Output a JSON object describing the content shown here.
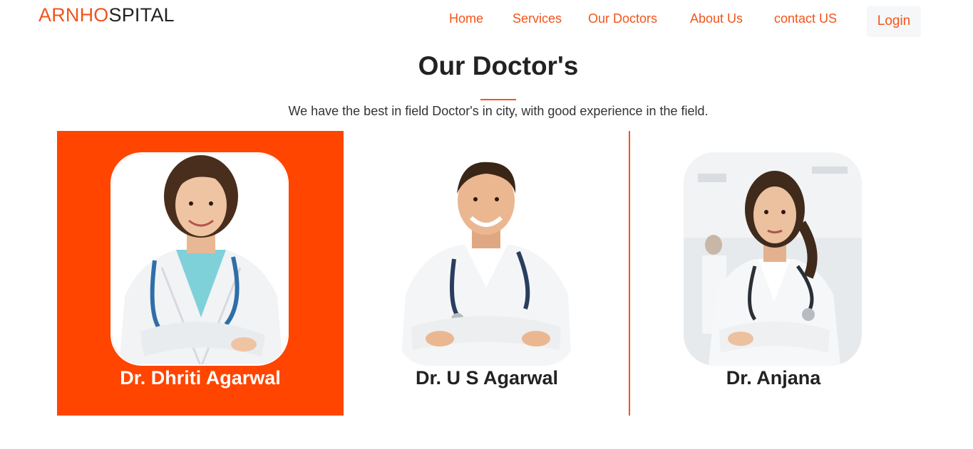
{
  "brand": {
    "accent": "ARNHO",
    "rest": "SPITAL"
  },
  "nav": {
    "items": [
      "Home",
      "Services",
      "Our Doctors",
      "About Us",
      "contact US"
    ],
    "login": "Login"
  },
  "section": {
    "title": "Our Doctor's",
    "subtitle": "We have the best in field Doctor's in city, with good experience in the field."
  },
  "doctors": [
    {
      "name": "Dr. Dhriti Agarwal",
      "selected": true,
      "photo": "female-doctor-smiling-photo"
    },
    {
      "name": "Dr. U S Agarwal",
      "selected": false,
      "photo": "male-doctor-smiling-photo"
    },
    {
      "name": "Dr. Anjana",
      "selected": false,
      "photo": "female-doctor-hospital-photo"
    }
  ],
  "colors": {
    "accent": "#f2541b",
    "card_highlight": "#ff4500",
    "text": "#222222"
  }
}
